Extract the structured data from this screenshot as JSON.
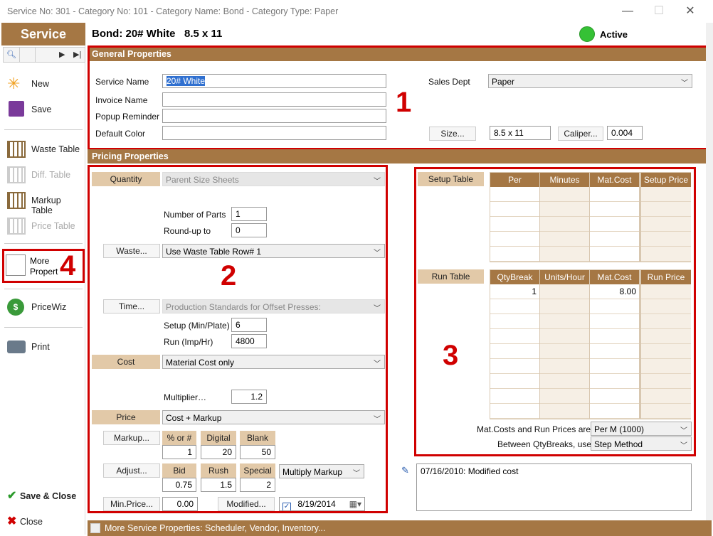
{
  "window": {
    "title": "Service No: 301  -  Category No: 101  -  Category Name: Bond  -  Category Type: Paper",
    "min": "—",
    "max": "☐",
    "close": "✕"
  },
  "header": {
    "tab": "Service",
    "title": "Bond: 20# White   8.5 x 11",
    "status": "Active",
    "status_color": "#35c135"
  },
  "sidebar": {
    "new": "New",
    "save": "Save",
    "waste": "Waste Table",
    "diff": "Diff. Table",
    "markup": "Markup Table",
    "price": "Price Table",
    "more": "More",
    "more2": "Propert",
    "pricewiz": "PriceWiz",
    "print": "Print",
    "save_close": "Save & Close",
    "close": "Close"
  },
  "general": {
    "bar": "General Properties",
    "service_name_label": "Service Name",
    "service_name": "20# White",
    "invoice_label": "Invoice Name",
    "invoice": "",
    "popup_label": "Popup Reminder",
    "popup": "",
    "color_label": "Default Color",
    "color": "",
    "sales_dept_label": "Sales Dept",
    "sales_dept": "Paper",
    "size_btn": "Size...",
    "size": "8.5 x 11",
    "caliper_btn": "Caliper...",
    "caliper": "0.004"
  },
  "pricing": {
    "bar": "Pricing Properties",
    "quantity": "Quantity",
    "quantity_val": "Parent Size Sheets",
    "parts_label": "Number of Parts",
    "parts": "1",
    "roundup_label": "Round-up to",
    "roundup": "0",
    "waste_btn": "Waste...",
    "waste_val": "Use Waste Table Row# 1",
    "time_btn": "Time...",
    "time_val": "Production Standards for Offset Presses:",
    "setup_label": "Setup (Min/Plate)",
    "setup": "6",
    "run_label": "Run (Imp/Hr)",
    "run": "4800",
    "cost": "Cost",
    "cost_val": "Material Cost only",
    "multiplier_label": "Multiplier…",
    "multiplier": "1.2",
    "price": "Price",
    "price_val": "Cost + Markup",
    "markup_btn": "Markup...",
    "pct": "% or #",
    "digital": "Digital",
    "blank": "Blank",
    "pct_v": "1",
    "digital_v": "20",
    "blank_v": "50",
    "adjust_btn": "Adjust...",
    "bid": "Bid",
    "rush": "Rush",
    "special": "Special",
    "bid_v": "0.75",
    "rush_v": "1.5",
    "special_v": "2",
    "adjust_mode": "Multiply Markup",
    "minprice_btn": "Min.Price...",
    "minprice": "0.00",
    "modified_btn": "Modified...",
    "modified": "8/19/2014"
  },
  "tables": {
    "setup_table": "Setup Table",
    "setup_cols": [
      "Per",
      "Minutes",
      "Mat.Cost",
      "Setup Price"
    ],
    "run_table": "Run Table",
    "run_cols": [
      "QtyBreak",
      "Units/Hour",
      "Mat.Cost",
      "Run Price"
    ],
    "run_rows": [
      [
        "1",
        "",
        "8.00",
        ""
      ]
    ],
    "matcost_label": "Mat.Costs and Run Prices are",
    "matcost_val": "Per M (1000)",
    "between_label": "Between QtyBreaks, use",
    "between_val": "Step Method"
  },
  "note": "07/16/2010: Modified cost",
  "bottom": "More Service Properties: Scheduler, Vendor, Inventory...",
  "annotations": {
    "n1": "1",
    "n2": "2",
    "n3": "3",
    "n4": "4"
  }
}
